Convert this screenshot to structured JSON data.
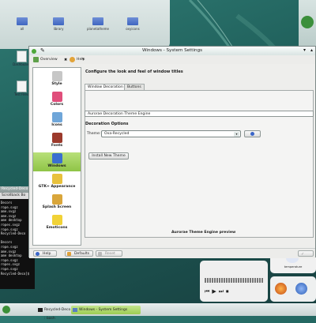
{
  "desktop": {
    "folders": [
      "all",
      "library",
      "planetatheme",
      "oxyicons"
    ],
    "files": [
      "Dashboard",
      "Test Files"
    ],
    "sidepanel_label": "Recycled-Deco"
  },
  "terminal": {
    "title": "Recycled-Deco",
    "menu": "Scrollback  Bo",
    "lines": [
      "Decors",
      "rope.svgz",
      "ame.svgz",
      "ame.svgz",
      "ame desktop",
      "ropes.svgz",
      "rope.svgz",
      "Recycled-Deco",
      "",
      "Decors",
      "rope.svgz",
      "ame.svgz",
      "ame desktop",
      "rope.svgz",
      "ropes.svgz",
      "rope.svgz",
      "Recycled-Deco]$"
    ]
  },
  "window": {
    "title": "Windows - System Settings",
    "toolbar": {
      "overview": "Overview",
      "help": "Help"
    },
    "sidebar": [
      {
        "label": "Style",
        "icon": "style-icon",
        "color": "#c7c7c7"
      },
      {
        "label": "Colors",
        "icon": "colors-icon",
        "color": "#e04e7b"
      },
      {
        "label": "Icons",
        "icon": "icons-icon",
        "color": "#6fa6d9"
      },
      {
        "label": "Fonts",
        "icon": "fonts-icon",
        "color": "#9c3a2c"
      },
      {
        "label": "Windows",
        "icon": "windows-icon",
        "color": "#3a6fd0"
      },
      {
        "label": "GTK+ Appearance",
        "icon": "gtk-icon",
        "color": "#e8c13c"
      },
      {
        "label": "Splash Screen",
        "icon": "splash-icon",
        "color": "#d9a63b"
      },
      {
        "label": "Emoticons",
        "icon": "emoticons-icon",
        "color": "#f1d237"
      }
    ],
    "selected_category": "Windows",
    "headline": "Configure the look and feel of window titles",
    "tabs": [
      "Window Decoration",
      "Buttons"
    ],
    "active_tab": "Window Decoration",
    "theme_engine": "Aurorae Decoration Theme Engine",
    "decoration_options": "Decoration Options",
    "theme_label": "Theme:",
    "theme_value": "Oxa-Recycled",
    "install_button": "Install New Theme",
    "preview_label": "Aurorae Theme Engine preview",
    "buttons": {
      "help": "Help",
      "defaults": "Defaults",
      "reset": "Reset"
    },
    "accent": "#8fc446"
  },
  "widgets": {
    "weather_label": "temperature"
  },
  "taskbar": {
    "items": [
      "Recycled-Deco : bash",
      "Windows - System Settings"
    ]
  }
}
